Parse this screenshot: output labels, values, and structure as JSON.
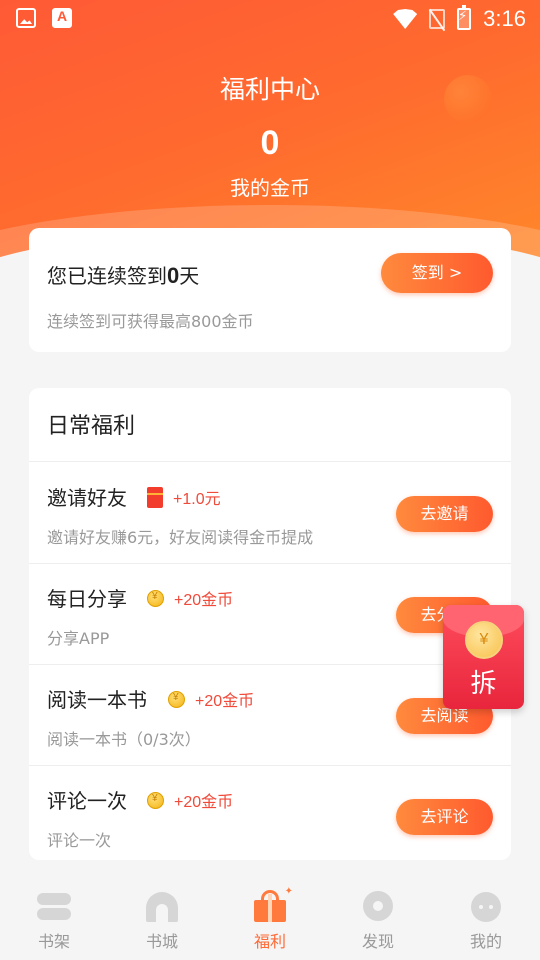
{
  "status_bar": {
    "time": "3:16",
    "left_icons": [
      "image-icon",
      "app-icon"
    ],
    "right_icons": [
      "wifi-icon",
      "no-sim-icon",
      "battery-charging-icon"
    ]
  },
  "header": {
    "title": "福利中心",
    "coins_value": "0",
    "coins_label": "我的金币"
  },
  "signin": {
    "title_prefix": "您已连续签到",
    "days": "0",
    "title_suffix": "天",
    "subtitle": "连续签到可获得最高800金币",
    "button_label": "签到 >"
  },
  "daily": {
    "title": "日常福利",
    "tasks": [
      {
        "name": "邀请好友",
        "reward_icon": "red-packet-icon",
        "reward": "+1.0元",
        "desc": "邀请好友赚6元，好友阅读得金币提成",
        "button": "去邀请"
      },
      {
        "name": "每日分享",
        "reward_icon": "coin-icon",
        "reward": "+20金币",
        "desc": "分享APP",
        "button": "去分享"
      },
      {
        "name": "阅读一本书",
        "reward_icon": "coin-icon",
        "reward": "+20金币",
        "desc": "阅读一本书（0/3次）",
        "button": "去阅读"
      },
      {
        "name": "评论一次",
        "reward_icon": "coin-icon",
        "reward": "+20金币",
        "desc": "评论一次",
        "button": "去评论"
      }
    ]
  },
  "envelope": {
    "coin_symbol": "¥",
    "label": "拆"
  },
  "bottom_nav": {
    "items": [
      {
        "label": "书架",
        "icon": "bookshelf-icon"
      },
      {
        "label": "书城",
        "icon": "bookstore-icon"
      },
      {
        "label": "福利",
        "icon": "gift-icon",
        "active": true
      },
      {
        "label": "发现",
        "icon": "discover-icon"
      },
      {
        "label": "我的",
        "icon": "profile-icon"
      }
    ]
  },
  "colors": {
    "accent": "#ff6a36",
    "reward_text": "#f04a3a",
    "envelope": "#e8253c"
  }
}
